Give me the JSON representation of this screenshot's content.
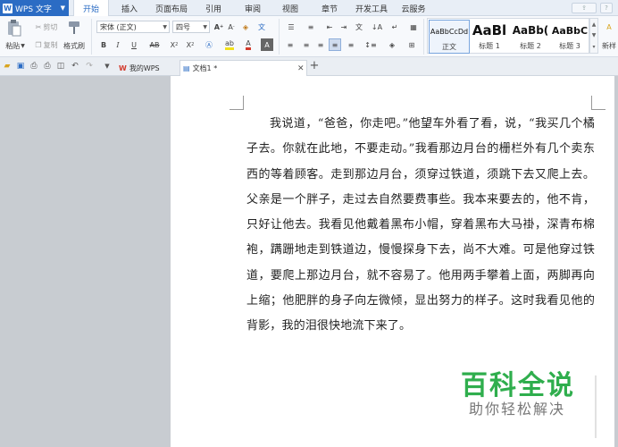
{
  "app": {
    "name": "WPS 文字"
  },
  "menu": {
    "tabs": [
      "开始",
      "插入",
      "页面布局",
      "引用",
      "审阅",
      "视图",
      "章节",
      "开发工具",
      "云服务"
    ],
    "active": "开始"
  },
  "ribbon": {
    "paste": "粘贴",
    "cut": "剪切",
    "copy": "复制",
    "format_painter": "格式刷",
    "font_name": "宋体 (正文)",
    "font_size": "四号",
    "styles": [
      {
        "preview": "AaBbCcDd",
        "label": "正文"
      },
      {
        "preview": "AaBl",
        "label": "标题 1"
      },
      {
        "preview": "AaBb(",
        "label": "标题 2"
      },
      {
        "preview": "AaBbC",
        "label": "标题 3"
      }
    ],
    "new_style": "新样"
  },
  "tabs": {
    "items": [
      {
        "label": "我的WPS"
      },
      {
        "label": "文档1 *"
      }
    ]
  },
  "document": {
    "paragraph": "我说道，“爸爸，你走吧。”他望车外看了看，说，“我买几个橘子去。你就在此地，不要走动。”我看那边月台的栅栏外有几个卖东西的等着顾客。走到那边月台，须穿过铁道，须跳下去又爬上去。父亲是一个胖子，走过去自然要费事些。我本来要去的，他不肯，只好让他去。我看见他戴着黑布小帽，穿着黑布大马褂，深青布棉袍，蹒跚地走到铁道边，慢慢探身下去，尚不大难。可是他穿过铁道，要爬上那边月台，就不容易了。他用两手攀着上面，两脚再向上缩；他肥胖的身子向左微倾，显出努力的样子。这时我看见他的背影，我的泪很快地流下来了。"
  },
  "watermark": {
    "title": "百科全说",
    "subtitle": "助你轻松解决"
  },
  "colors": {
    "accent": "#2b6cc4",
    "watermark_green": "#2fae4d",
    "wps_red": "#d33a2c"
  }
}
